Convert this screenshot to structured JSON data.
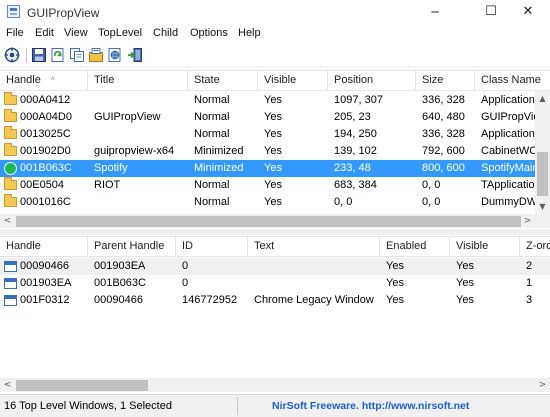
{
  "window": {
    "title": "GUIPropView",
    "controls": {
      "minimize": "─",
      "maximize": "☐",
      "close": "✕"
    }
  },
  "menu": [
    "File",
    "Edit",
    "View",
    "TopLevel",
    "Child",
    "Options",
    "Help"
  ],
  "toolbar": {
    "icons": [
      "find-window-icon",
      "save-icon",
      "refresh-icon",
      "copy-icon",
      "properties-icon",
      "html-report-icon",
      "exit-icon"
    ]
  },
  "top_list": {
    "columns": [
      "Handle",
      "Title",
      "State",
      "Visible",
      "Position",
      "Size",
      "Class Name"
    ],
    "sort_indicator": "^",
    "rows": [
      {
        "icon": "folder-icon",
        "handle": "000A0412",
        "title": "",
        "state": "Normal",
        "visible": "Yes",
        "position": "1097, 307",
        "size": "336, 328",
        "class": "Application",
        "selected": false
      },
      {
        "icon": "folder-icon",
        "handle": "000A04D0",
        "title": "GUIPropView",
        "state": "Normal",
        "visible": "Yes",
        "position": "205, 23",
        "size": "640, 480",
        "class": "GUIPropView",
        "selected": false
      },
      {
        "icon": "folder-icon",
        "handle": "0013025C",
        "title": "",
        "state": "Normal",
        "visible": "Yes",
        "position": "194, 250",
        "size": "336, 328",
        "class": "Application",
        "selected": false
      },
      {
        "icon": "folder-icon",
        "handle": "001902D0",
        "title": "guipropview-x64",
        "state": "Minimized",
        "visible": "Yes",
        "position": "139, 102",
        "size": "792, 600",
        "class": "CabinetWC",
        "selected": false
      },
      {
        "icon": "spotify-icon",
        "handle": "001B063C",
        "title": "Spotify",
        "state": "Minimized",
        "visible": "Yes",
        "position": "233, 48",
        "size": "800, 600",
        "class": "SpotifyMain",
        "selected": true
      },
      {
        "icon": "folder-icon",
        "handle": "00E0504",
        "title": "RIOT",
        "state": "Normal",
        "visible": "Yes",
        "position": "683, 384",
        "size": "0, 0",
        "class": "TApplication",
        "selected": false
      },
      {
        "icon": "folder-icon",
        "handle": "0001016C",
        "title": "",
        "state": "Normal",
        "visible": "Yes",
        "position": "0, 0",
        "size": "0, 0",
        "class": "DummyDW",
        "selected": false
      }
    ]
  },
  "bottom_list": {
    "columns": [
      "Handle",
      "Parent Handle",
      "ID",
      "Text",
      "Enabled",
      "Visible",
      "Z-ord"
    ],
    "rows": [
      {
        "icon": "window-icon",
        "handle": "00090466",
        "parent": "001903EA",
        "id": "0",
        "text": "",
        "enabled": "Yes",
        "visible": "Yes",
        "z": "2"
      },
      {
        "icon": "window-icon",
        "handle": "001903EA",
        "parent": "001B063C",
        "id": "0",
        "text": "",
        "enabled": "Yes",
        "visible": "Yes",
        "z": "1"
      },
      {
        "icon": "window-icon",
        "handle": "001F0312",
        "parent": "00090466",
        "id": "146772952",
        "text": "Chrome Legacy Window",
        "enabled": "Yes",
        "visible": "Yes",
        "z": "3"
      }
    ]
  },
  "scroll": {
    "left_arrow": "<",
    "right_arrow": ">",
    "up_arrow": "▲",
    "down_arrow": "▼"
  },
  "status": {
    "left": "16 Top Level Windows, 1 Selected",
    "link": "NirSoft Freeware.  http://www.nirsoft.net"
  },
  "colors": {
    "selection": "#3399ff",
    "link": "#1d5fcf",
    "alt_row": "#f0f0f0"
  }
}
